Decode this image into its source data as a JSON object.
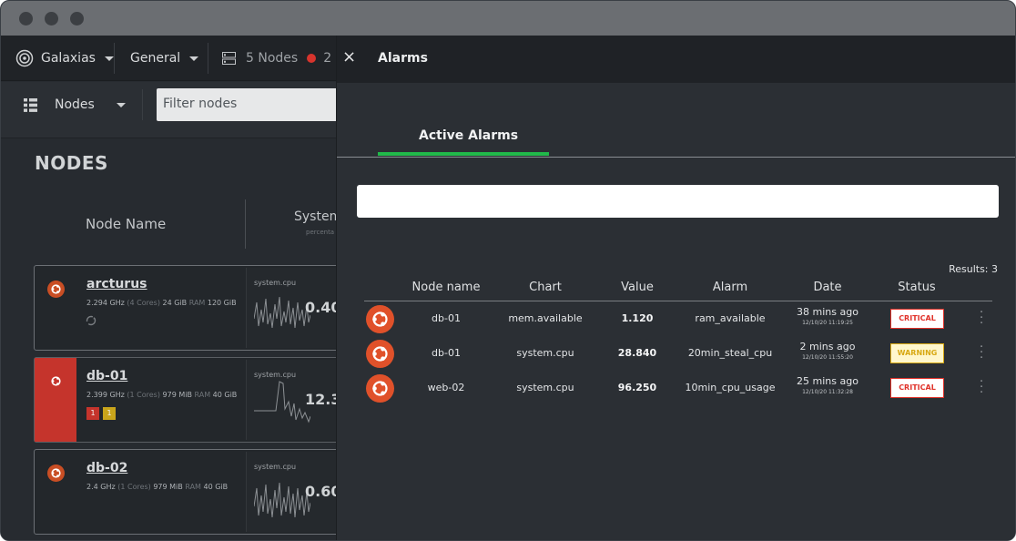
{
  "topbar": {
    "space_name": "Galaxias",
    "room_name": "General",
    "nodes_count": "5 Nodes",
    "critical_count": "2"
  },
  "secbar": {
    "view_label": "Nodes",
    "filter_placeholder": "Filter nodes"
  },
  "nodes_view": {
    "title": "NODES",
    "col_node_name": "Node Name",
    "col_system": "System",
    "col_system_sub": "percenta",
    "cards": [
      {
        "name": "arcturus",
        "ghz": "2.294 GHz",
        "cores": "(4 Cores)",
        "ram": "24 GiB",
        "ram_label": "RAM",
        "disk": "120 GiB",
        "chart": "system.cpu",
        "value": "0.40",
        "alert": false
      },
      {
        "name": "db-01",
        "ghz": "2.399 GHz",
        "cores": "(1 Cores)",
        "ram": "979 MiB",
        "ram_label": "RAM",
        "disk": "40 GiB",
        "chart": "system.cpu",
        "value": "12.3",
        "alert": true,
        "badge_critical": "1",
        "badge_warning": "1"
      },
      {
        "name": "db-02",
        "ghz": "2.4 GHz",
        "cores": "(1 Cores)",
        "ram": "979 MiB",
        "ram_label": "RAM",
        "disk": "40 GiB",
        "chart": "system.cpu",
        "value": "0.60",
        "alert": false
      }
    ]
  },
  "alarms_panel": {
    "title": "Alarms",
    "close_label": "×",
    "tab_label": "Active Alarms",
    "results_label": "Results: 3",
    "columns": [
      "Node name",
      "Chart",
      "Value",
      "Alarm",
      "Date",
      "Status"
    ],
    "rows": [
      {
        "node": "db-01",
        "chart": "mem.available",
        "value": "1.120",
        "alarm": "ram_available",
        "date": "38 mins ago",
        "date_full": "12/10/20 11:19:25",
        "status": "CRITICAL"
      },
      {
        "node": "db-01",
        "chart": "system.cpu",
        "value": "28.840",
        "alarm": "20min_steal_cpu",
        "date": "2 mins ago",
        "date_full": "12/10/20 11:55:20",
        "status": "WARNING"
      },
      {
        "node": "web-02",
        "chart": "system.cpu",
        "value": "96.250",
        "alarm": "10min_cpu_usage",
        "date": "25 mins ago",
        "date_full": "12/10/20 11:32:28",
        "status": "CRITICAL"
      }
    ]
  },
  "colors": {
    "accent_green": "#21b94a",
    "critical_red": "#e0322a",
    "warning_yellow": "#d8a913",
    "ubuntu_orange": "#e0512a"
  }
}
